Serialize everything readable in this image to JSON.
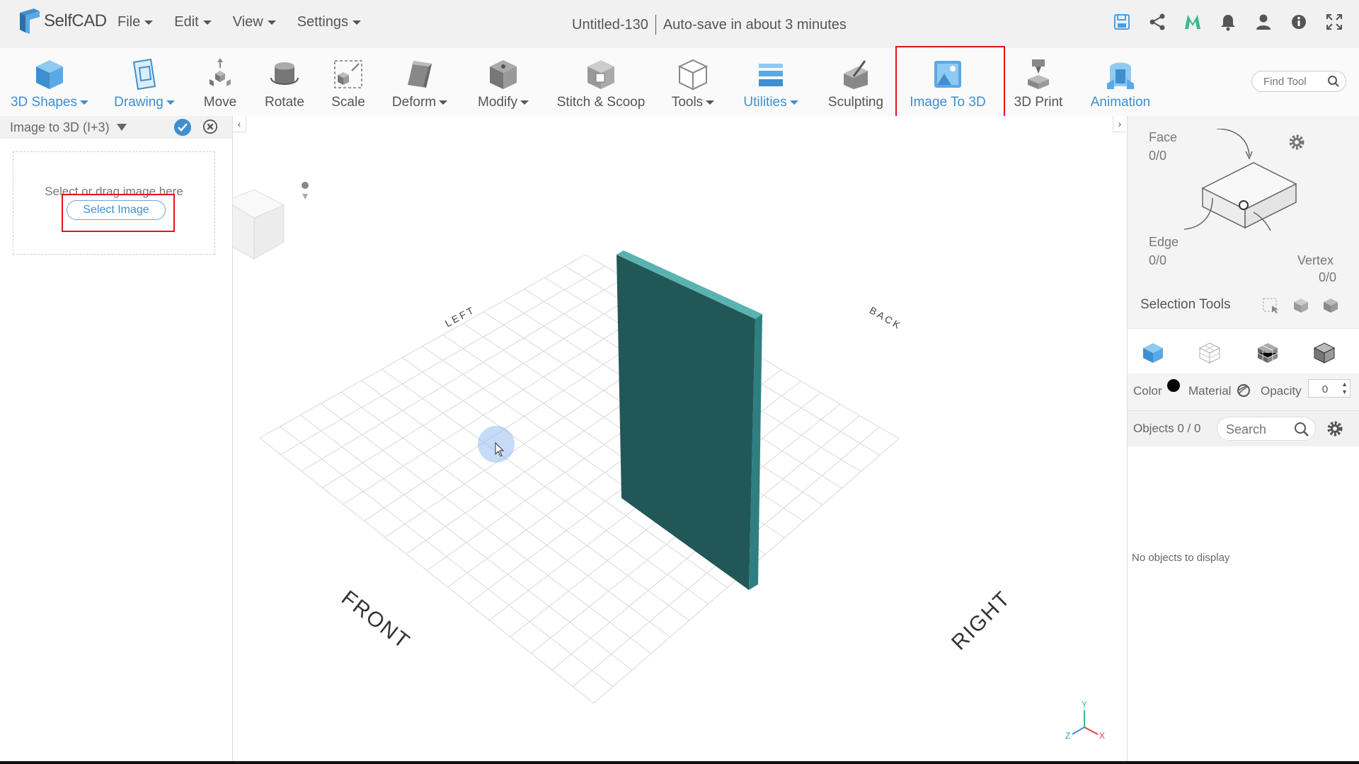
{
  "app": {
    "name": "SelfCAD",
    "document_title": "Untitled-130",
    "autosave_text": "Auto-save in about 3 minutes"
  },
  "menu": [
    {
      "label": "File"
    },
    {
      "label": "Edit"
    },
    {
      "label": "View"
    },
    {
      "label": "Settings"
    }
  ],
  "top_icons": [
    "save-icon",
    "share-icon",
    "m-logo-icon",
    "bell-icon",
    "user-icon",
    "info-icon",
    "fullscreen-icon"
  ],
  "toolbar": {
    "tools": [
      {
        "label": "3D Shapes",
        "dropdown": true,
        "blue": true,
        "icon": "cube-icon"
      },
      {
        "label": "Drawing",
        "dropdown": true,
        "blue": true,
        "icon": "drawing-icon"
      },
      {
        "label": "Move",
        "dropdown": false,
        "blue": false,
        "icon": "move-icon"
      },
      {
        "label": "Rotate",
        "dropdown": false,
        "blue": false,
        "icon": "rotate-icon"
      },
      {
        "label": "Scale",
        "dropdown": false,
        "blue": false,
        "icon": "scale-icon"
      },
      {
        "label": "Deform",
        "dropdown": true,
        "blue": false,
        "icon": "deform-icon"
      },
      {
        "label": "Modify",
        "dropdown": true,
        "blue": false,
        "icon": "modify-icon"
      },
      {
        "label": "Stitch & Scoop",
        "dropdown": false,
        "blue": false,
        "icon": "stitch-scoop-icon"
      },
      {
        "label": "Tools",
        "dropdown": true,
        "blue": false,
        "icon": "tools-icon"
      },
      {
        "label": "Utilities",
        "dropdown": true,
        "blue": true,
        "icon": "utilities-icon"
      },
      {
        "label": "Sculpting",
        "dropdown": false,
        "blue": false,
        "icon": "sculpting-icon"
      },
      {
        "label": "Image To 3D",
        "dropdown": false,
        "blue": true,
        "icon": "image-to-3d-icon"
      },
      {
        "label": "3D Print",
        "dropdown": false,
        "blue": false,
        "icon": "3d-print-icon"
      },
      {
        "label": "Animation",
        "dropdown": false,
        "blue": true,
        "icon": "animation-icon"
      }
    ],
    "find_tool_placeholder": "Find Tool"
  },
  "left_panel": {
    "title": "Image to 3D (I+3)",
    "dropzone_text": "Select or drag image here",
    "select_button": "Select Image"
  },
  "viewport": {
    "labels": {
      "left": "LEFT",
      "back": "BACK",
      "front": "FRONT",
      "right": "RIGHT"
    },
    "axis": {
      "y": "Y",
      "z": "Z",
      "x": "X"
    },
    "object_color": "#23585a"
  },
  "right_panel": {
    "face_label": "Face",
    "face_value": "0/0",
    "edge_label": "Edge",
    "edge_value": "0/0",
    "vertex_label": "Vertex",
    "vertex_value": "0/0",
    "selection_tools_label": "Selection Tools",
    "color_label": "Color",
    "material_label": "Material",
    "opacity_label": "Opacity",
    "opacity_value": "0",
    "objects_label": "Objects 0 / 0",
    "search_placeholder": "Search",
    "no_objects": "No objects to display"
  },
  "colors": {
    "accent": "#3f8fd0",
    "highlight": "#e0141e",
    "object_teal": "#23585a",
    "object_top": "#4fa8a8"
  }
}
